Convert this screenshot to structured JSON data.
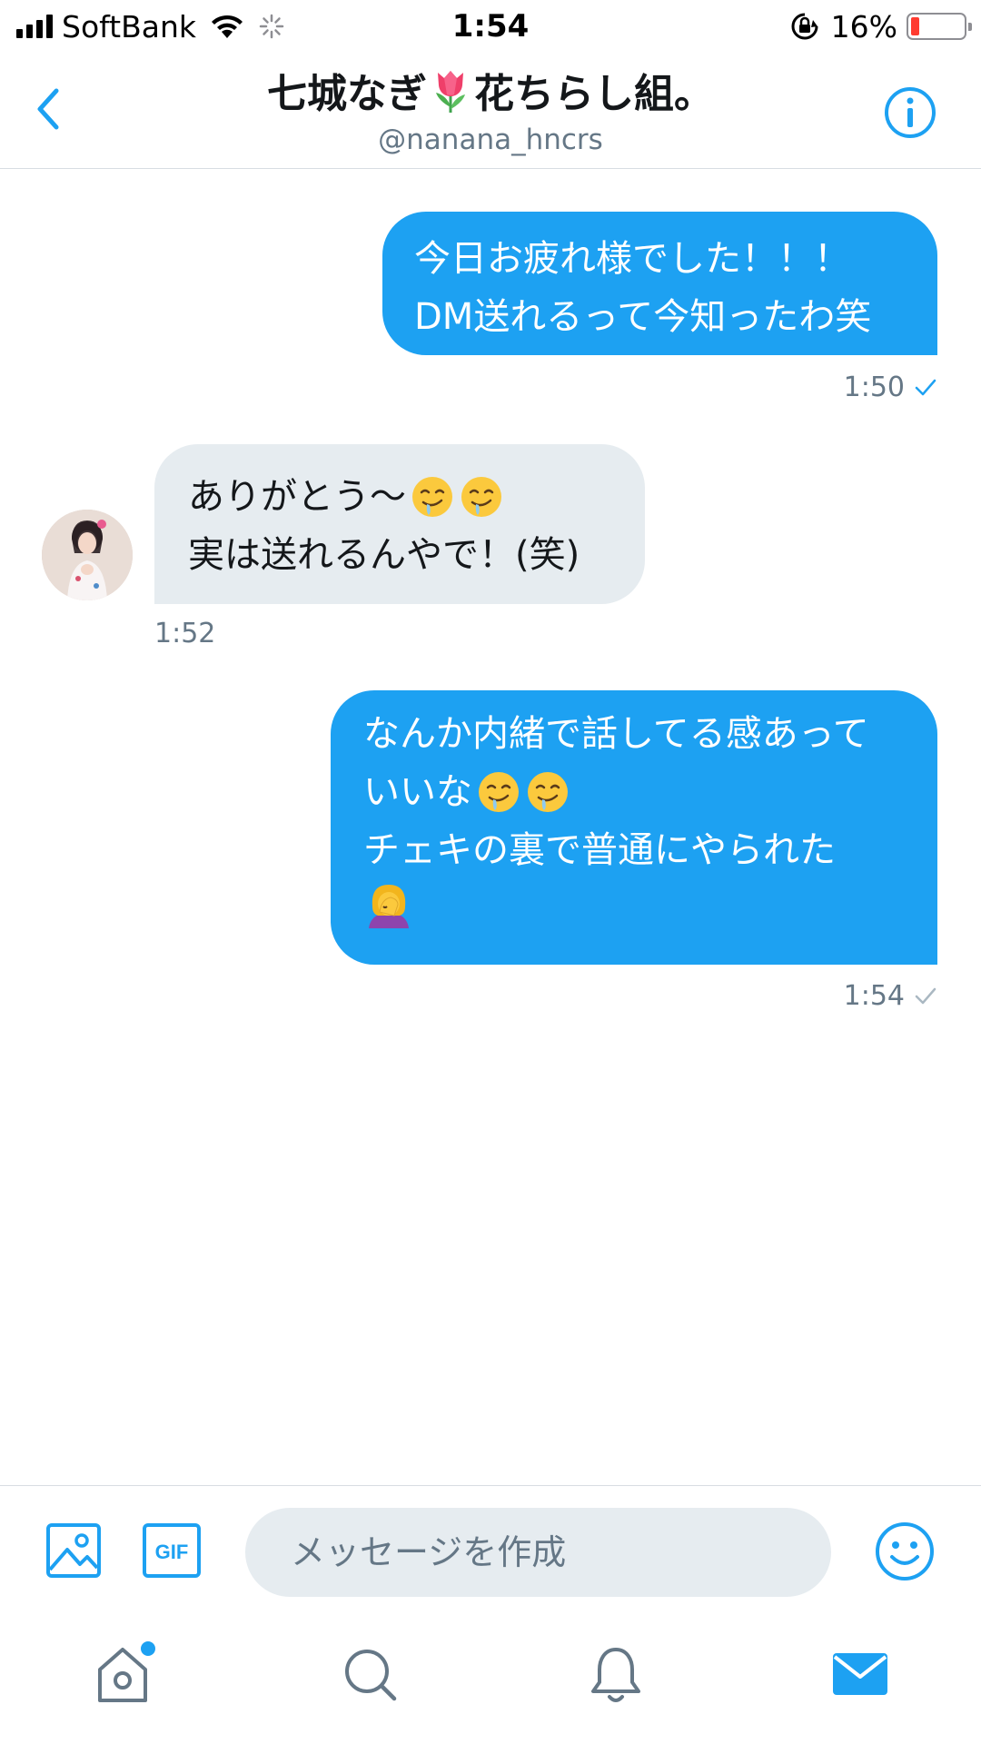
{
  "status_bar": {
    "carrier": "SoftBank",
    "time": "1:54",
    "battery_percent": "16%",
    "battery_level": 0.16,
    "icons": [
      "signal-icon",
      "wifi-icon",
      "activity-spinner-icon",
      "orientation-lock-icon",
      "battery-icon"
    ]
  },
  "header": {
    "title_part1": "七城なぎ",
    "title_emoji": "tulip-emoji",
    "title_part2": "花ちらし組。",
    "handle": "@nanana_hncrs",
    "back_icon": "chevron-left-icon",
    "info_icon": "info-icon"
  },
  "messages": [
    {
      "direction": "sent",
      "lines": [
        "今日お疲れ様でした！！！",
        "DM送れるって今知ったわ笑"
      ],
      "time": "1:50"
    },
    {
      "direction": "received",
      "line1_text": "ありがとう〜",
      "line1_emojis": [
        "drooling-face-emoji",
        "drooling-face-emoji"
      ],
      "line2": "実は送れるんやで！(笑)",
      "time": "1:52"
    },
    {
      "direction": "sent",
      "line1": "なんか内緒で話してる感あって",
      "line2_text": "いいな",
      "line2_emojis": [
        "drooling-face-emoji",
        "drooling-face-emoji"
      ],
      "line3": "チェキの裏で普通にやられた",
      "line4_emojis": [
        "woman-facepalming-emoji"
      ],
      "time": "1:54"
    }
  ],
  "compose": {
    "placeholder": "メッセージを作成",
    "gif_label": "GIF",
    "icons": [
      "image-icon",
      "gif-icon",
      "emoji-icon"
    ]
  },
  "tab_bar": {
    "tabs": [
      "home-icon",
      "search-icon",
      "notifications-icon",
      "messages-icon"
    ],
    "active_tab": "messages-icon",
    "home_has_notification_dot": true
  },
  "colors": {
    "accent": "#1da1f2",
    "received_bubble": "#e6ecf0",
    "secondary_text": "#657786",
    "battery_low": "#ff3b30"
  }
}
